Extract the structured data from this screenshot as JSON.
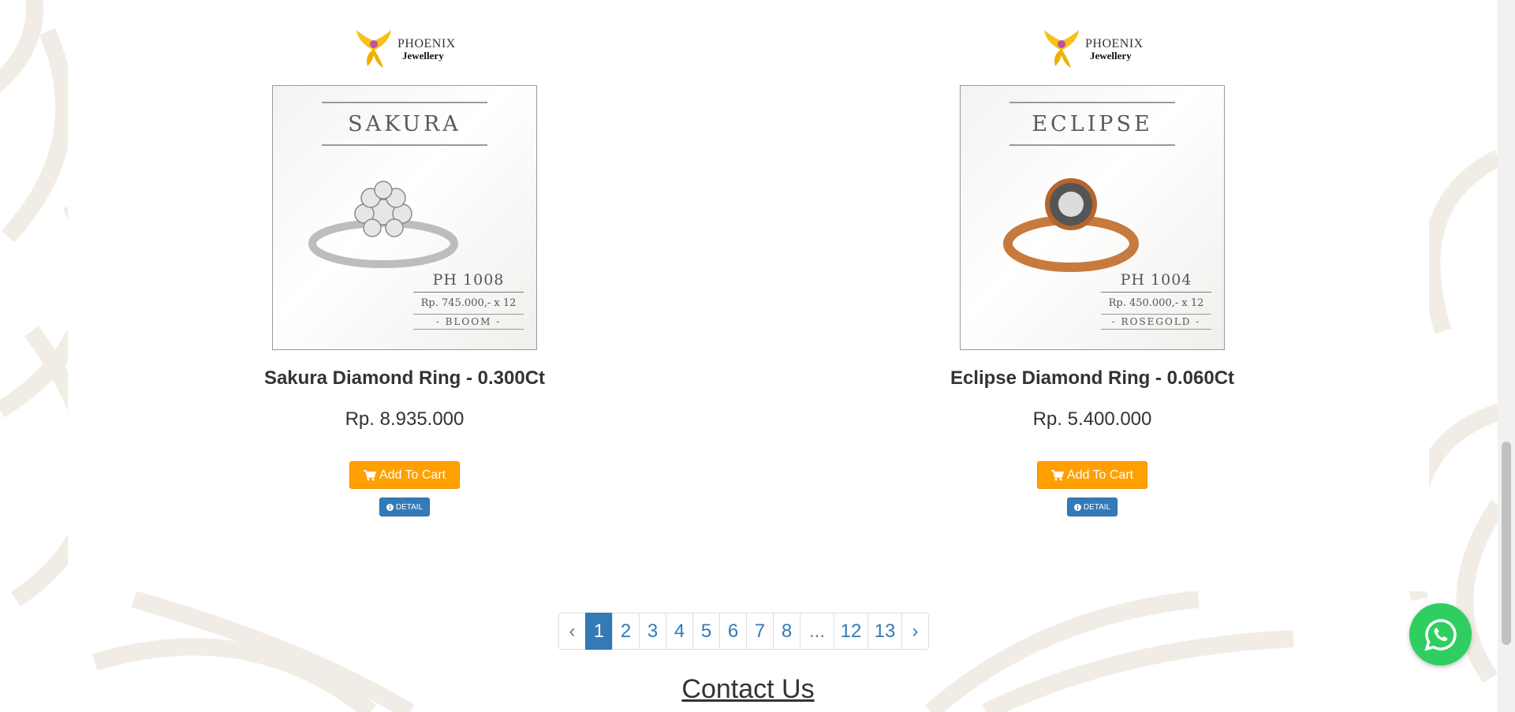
{
  "products": [
    {
      "brand": {
        "line1": "PHOENIX",
        "line2": "Jewellery"
      },
      "image": {
        "title": "SAKURA",
        "code": "PH 1008",
        "installment": "Rp. 745.000,- x 12",
        "variant": "- BLOOM -",
        "metal_color": "#c9c9c9"
      },
      "name": "Sakura Diamond Ring - 0.300Ct",
      "price": "Rp. 8.935.000",
      "add_to_cart_label": "Add To Cart",
      "detail_label": "DETAIL"
    },
    {
      "brand": {
        "line1": "PHOENIX",
        "line2": "Jewellery"
      },
      "image": {
        "title": "ECLIPSE",
        "code": "PH 1004",
        "installment": "Rp. 450.000,- x 12",
        "variant": "- ROSEGOLD -",
        "metal_color": "#c77a3e"
      },
      "name": "Eclipse Diamond Ring - 0.060Ct",
      "price": "Rp. 5.400.000",
      "add_to_cart_label": "Add To Cart",
      "detail_label": "DETAIL"
    }
  ],
  "pagination": {
    "prev": "‹",
    "pages": [
      "1",
      "2",
      "3",
      "4",
      "5",
      "6",
      "7",
      "8",
      "...",
      "12",
      "13"
    ],
    "active": "1",
    "next": "›"
  },
  "contact": {
    "title": "Contact Us"
  },
  "colors": {
    "add_to_cart": "#ff9f00",
    "detail": "#337ab7",
    "pagination_active": "#337ab7",
    "whatsapp": "#2ecf60"
  },
  "icons": {
    "cart": "shopping-cart-icon",
    "info": "info-circle-icon",
    "whatsapp": "whatsapp-icon"
  }
}
